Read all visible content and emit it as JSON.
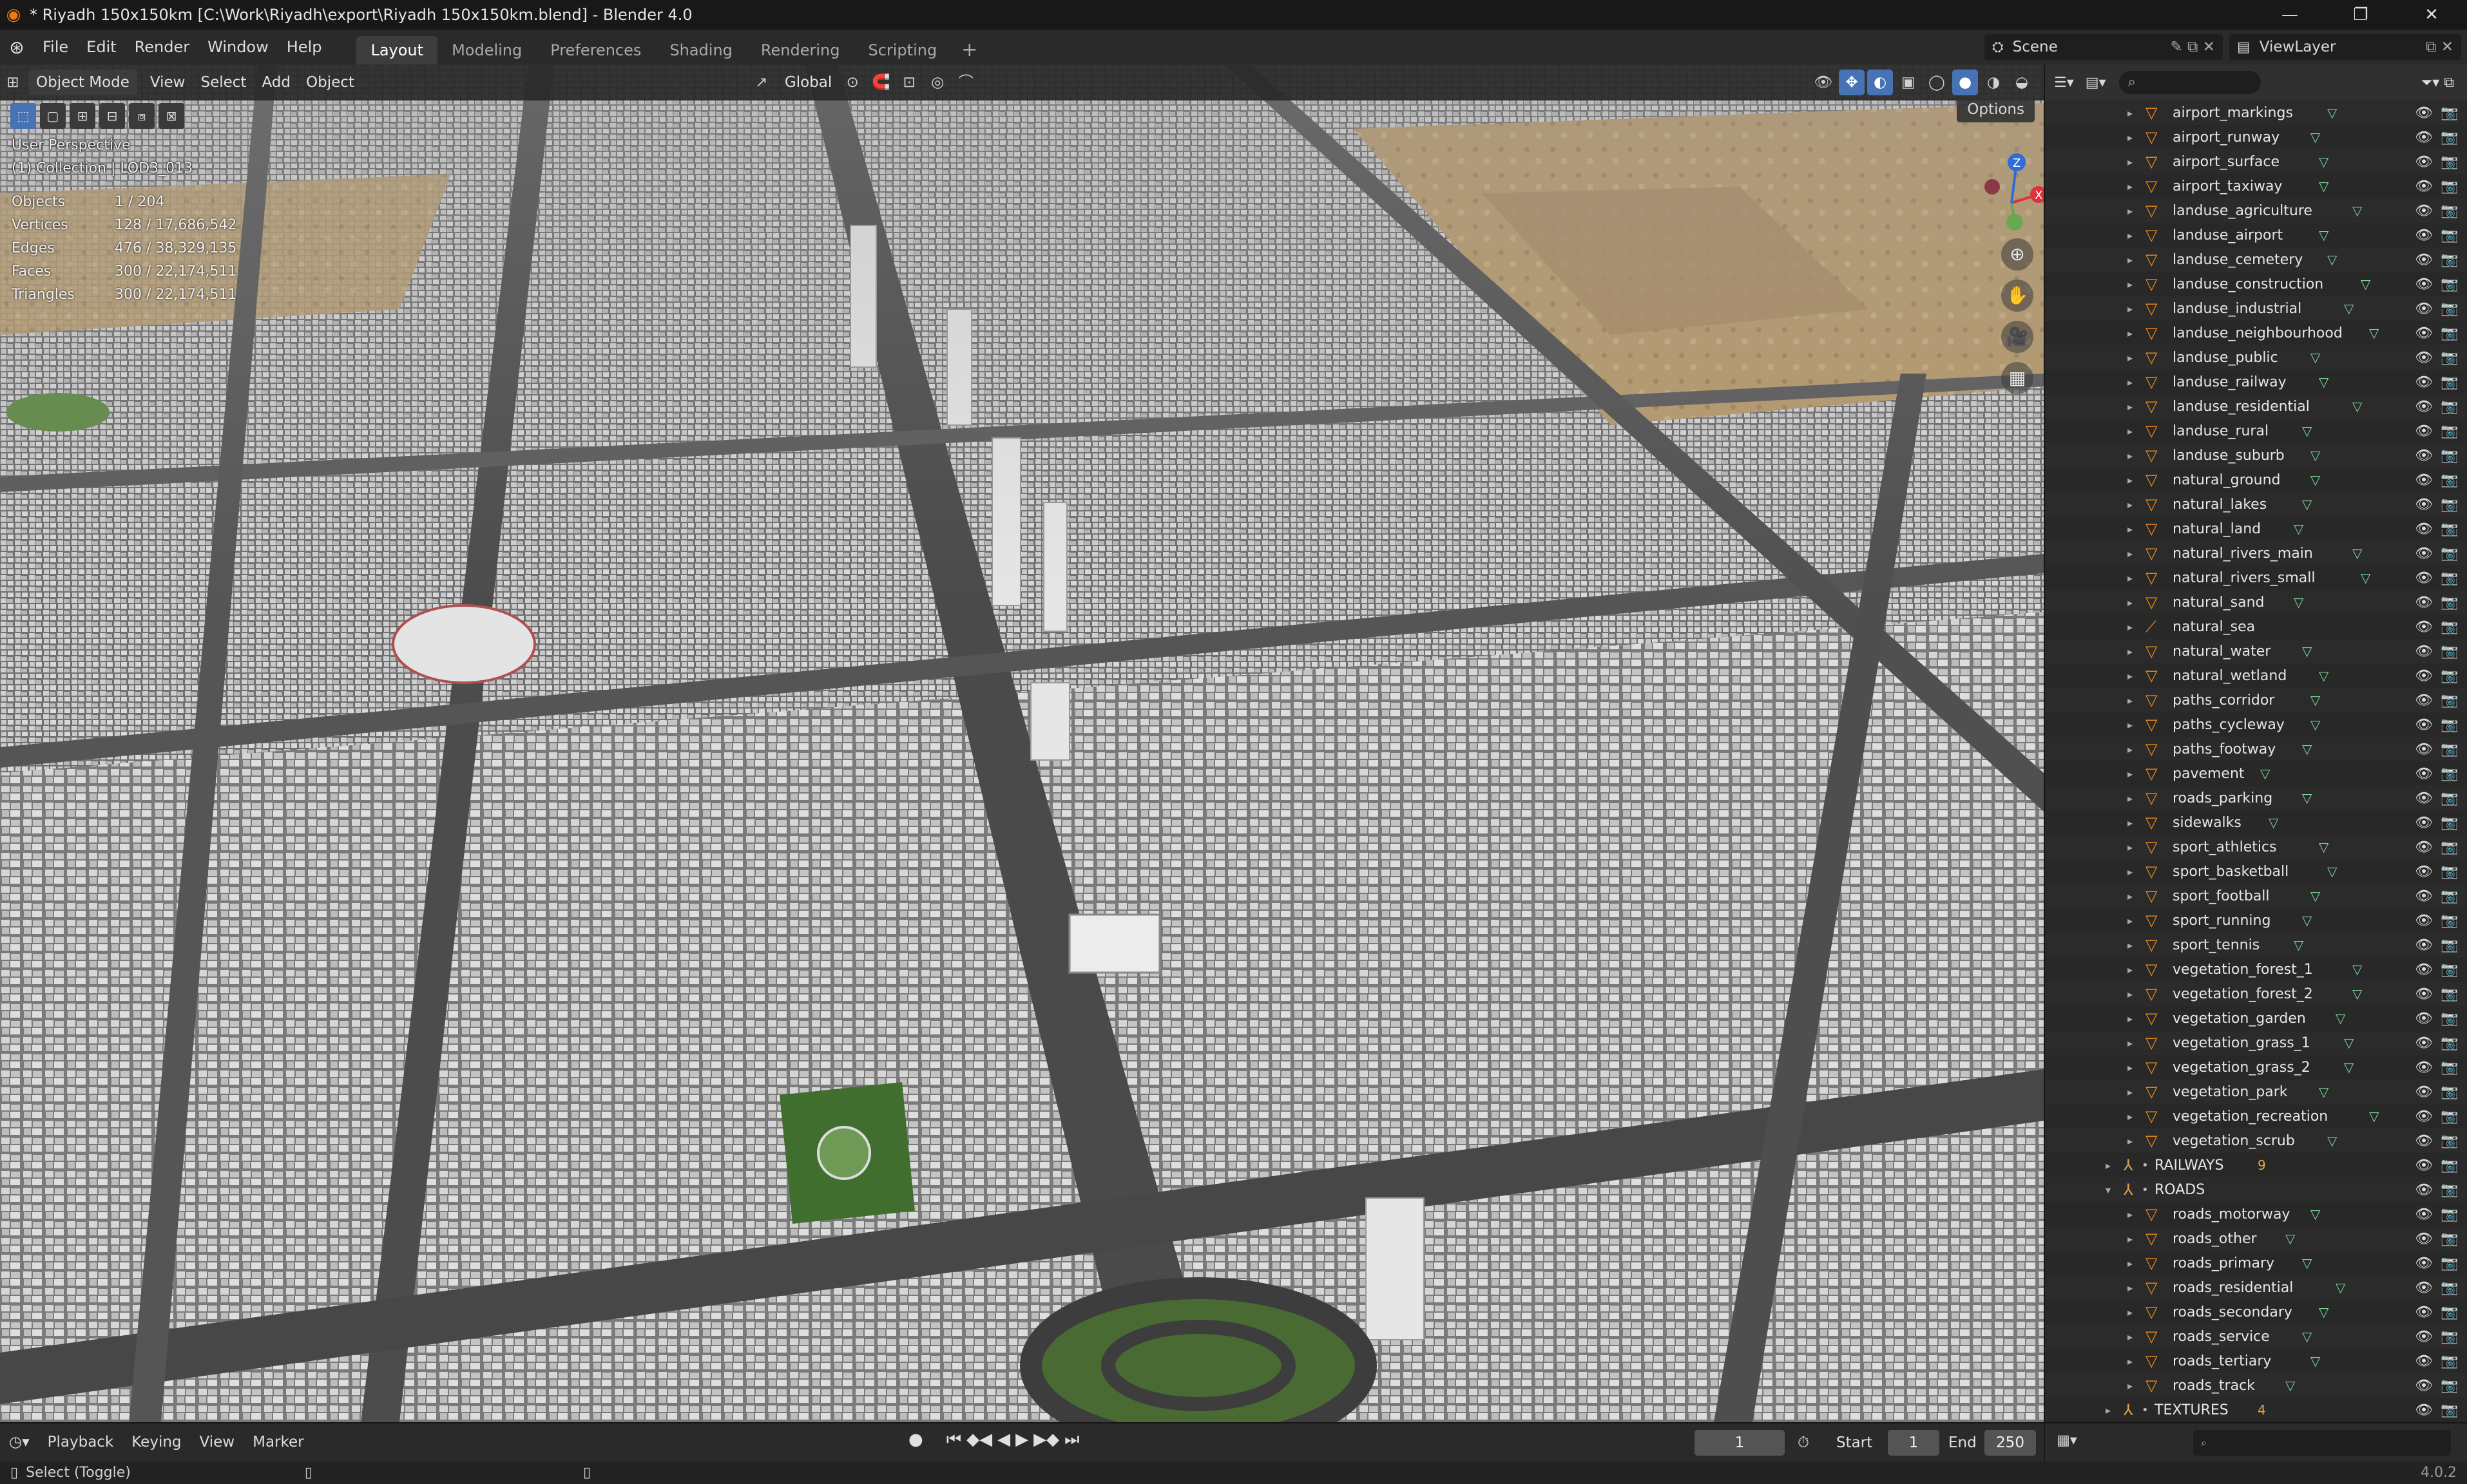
{
  "window": {
    "title": "* Riyadh 150x150km [C:\\Work\\Riyadh\\export\\Riyadh 150x150km.blend] - Blender 4.0",
    "controls": [
      "—",
      "❐",
      "✕"
    ]
  },
  "menu": [
    "File",
    "Edit",
    "Render",
    "Window",
    "Help"
  ],
  "workspaces": [
    {
      "label": "Layout",
      "active": true
    },
    {
      "label": "Modeling",
      "active": false
    },
    {
      "label": "Preferences",
      "active": false
    },
    {
      "label": "Shading",
      "active": false
    },
    {
      "label": "Rendering",
      "active": false
    },
    {
      "label": "Scripting",
      "active": false
    }
  ],
  "scene": {
    "label": "Scene"
  },
  "view_layer": {
    "label": "ViewLayer"
  },
  "viewport": {
    "mode": "Object Mode",
    "menus": [
      "View",
      "Select",
      "Add",
      "Object"
    ],
    "transform_orientation": "Global",
    "options": "Options",
    "perspective": "User Perspective",
    "collection": "(1) Collection | LOD3_013",
    "stats": [
      {
        "key": "Objects",
        "value": "1 / 204"
      },
      {
        "key": "Vertices",
        "value": "128 / 17,686,542"
      },
      {
        "key": "Edges",
        "value": "476 / 38,329,135"
      },
      {
        "key": "Faces",
        "value": "300 / 22,174,511"
      },
      {
        "key": "Triangles",
        "value": "300 / 22,174,511"
      }
    ],
    "gizmo": {
      "z": "Z",
      "x": "X"
    }
  },
  "outliner": {
    "items": [
      {
        "label": "airport_markings",
        "type": "object"
      },
      {
        "label": "airport_runway",
        "type": "object"
      },
      {
        "label": "airport_surface",
        "type": "object"
      },
      {
        "label": "airport_taxiway",
        "type": "object"
      },
      {
        "label": "landuse_agriculture",
        "type": "object"
      },
      {
        "label": "landuse_airport",
        "type": "object"
      },
      {
        "label": "landuse_cemetery",
        "type": "object"
      },
      {
        "label": "landuse_construction",
        "type": "object"
      },
      {
        "label": "landuse_industrial",
        "type": "object"
      },
      {
        "label": "landuse_neighbourhood",
        "type": "object"
      },
      {
        "label": "landuse_public",
        "type": "object"
      },
      {
        "label": "landuse_railway",
        "type": "object"
      },
      {
        "label": "landuse_residential",
        "type": "object"
      },
      {
        "label": "landuse_rural",
        "type": "object"
      },
      {
        "label": "landuse_suburb",
        "type": "object"
      },
      {
        "label": "natural_ground",
        "type": "object"
      },
      {
        "label": "natural_lakes",
        "type": "object"
      },
      {
        "label": "natural_land",
        "type": "object"
      },
      {
        "label": "natural_rivers_main",
        "type": "object"
      },
      {
        "label": "natural_rivers_small",
        "type": "object"
      },
      {
        "label": "natural_sand",
        "type": "object"
      },
      {
        "label": "natural_sea",
        "type": "empty"
      },
      {
        "label": "natural_water",
        "type": "object"
      },
      {
        "label": "natural_wetland",
        "type": "object"
      },
      {
        "label": "paths_corridor",
        "type": "object"
      },
      {
        "label": "paths_cycleway",
        "type": "object"
      },
      {
        "label": "paths_footway",
        "type": "object"
      },
      {
        "label": "pavement",
        "type": "object"
      },
      {
        "label": "roads_parking",
        "type": "object"
      },
      {
        "label": "sidewalks",
        "type": "object"
      },
      {
        "label": "sport_athletics",
        "type": "object"
      },
      {
        "label": "sport_basketball",
        "type": "object"
      },
      {
        "label": "sport_football",
        "type": "object"
      },
      {
        "label": "sport_running",
        "type": "object"
      },
      {
        "label": "sport_tennis",
        "type": "object"
      },
      {
        "label": "vegetation_forest_1",
        "type": "object"
      },
      {
        "label": "vegetation_forest_2",
        "type": "object"
      },
      {
        "label": "vegetation_garden",
        "type": "object"
      },
      {
        "label": "vegetation_grass_1",
        "type": "object"
      },
      {
        "label": "vegetation_grass_2",
        "type": "object"
      },
      {
        "label": "vegetation_park",
        "type": "object"
      },
      {
        "label": "vegetation_recreation",
        "type": "object"
      },
      {
        "label": "vegetation_scrub",
        "type": "object"
      },
      {
        "label": "RAILWAYS",
        "type": "collection",
        "badge": "9",
        "expanded": false
      },
      {
        "label": "ROADS",
        "type": "collection",
        "badge": "",
        "expanded": true
      },
      {
        "label": "roads_motorway",
        "type": "object"
      },
      {
        "label": "roads_other",
        "type": "object"
      },
      {
        "label": "roads_primary",
        "type": "object"
      },
      {
        "label": "roads_residential",
        "type": "object"
      },
      {
        "label": "roads_secondary",
        "type": "object"
      },
      {
        "label": "roads_service",
        "type": "object"
      },
      {
        "label": "roads_tertiary",
        "type": "object"
      },
      {
        "label": "roads_track",
        "type": "object"
      },
      {
        "label": "TEXTURES",
        "type": "collection",
        "badge": "4",
        "expanded": false
      }
    ]
  },
  "timeline": {
    "menus": [
      "Playback",
      "Keying",
      "View",
      "Marker"
    ],
    "current_frame": "1",
    "start_label": "Start",
    "start": "1",
    "end_label": "End",
    "end": "250"
  },
  "status": {
    "hint": "Select (Toggle)",
    "version": "4.0.2"
  },
  "colors": {
    "accent": "#4772b3",
    "object_icon": "#f08c1a",
    "modifier_icon": "#7ed39a",
    "axis_x": "#e0303e",
    "axis_z": "#2f6cd8"
  }
}
